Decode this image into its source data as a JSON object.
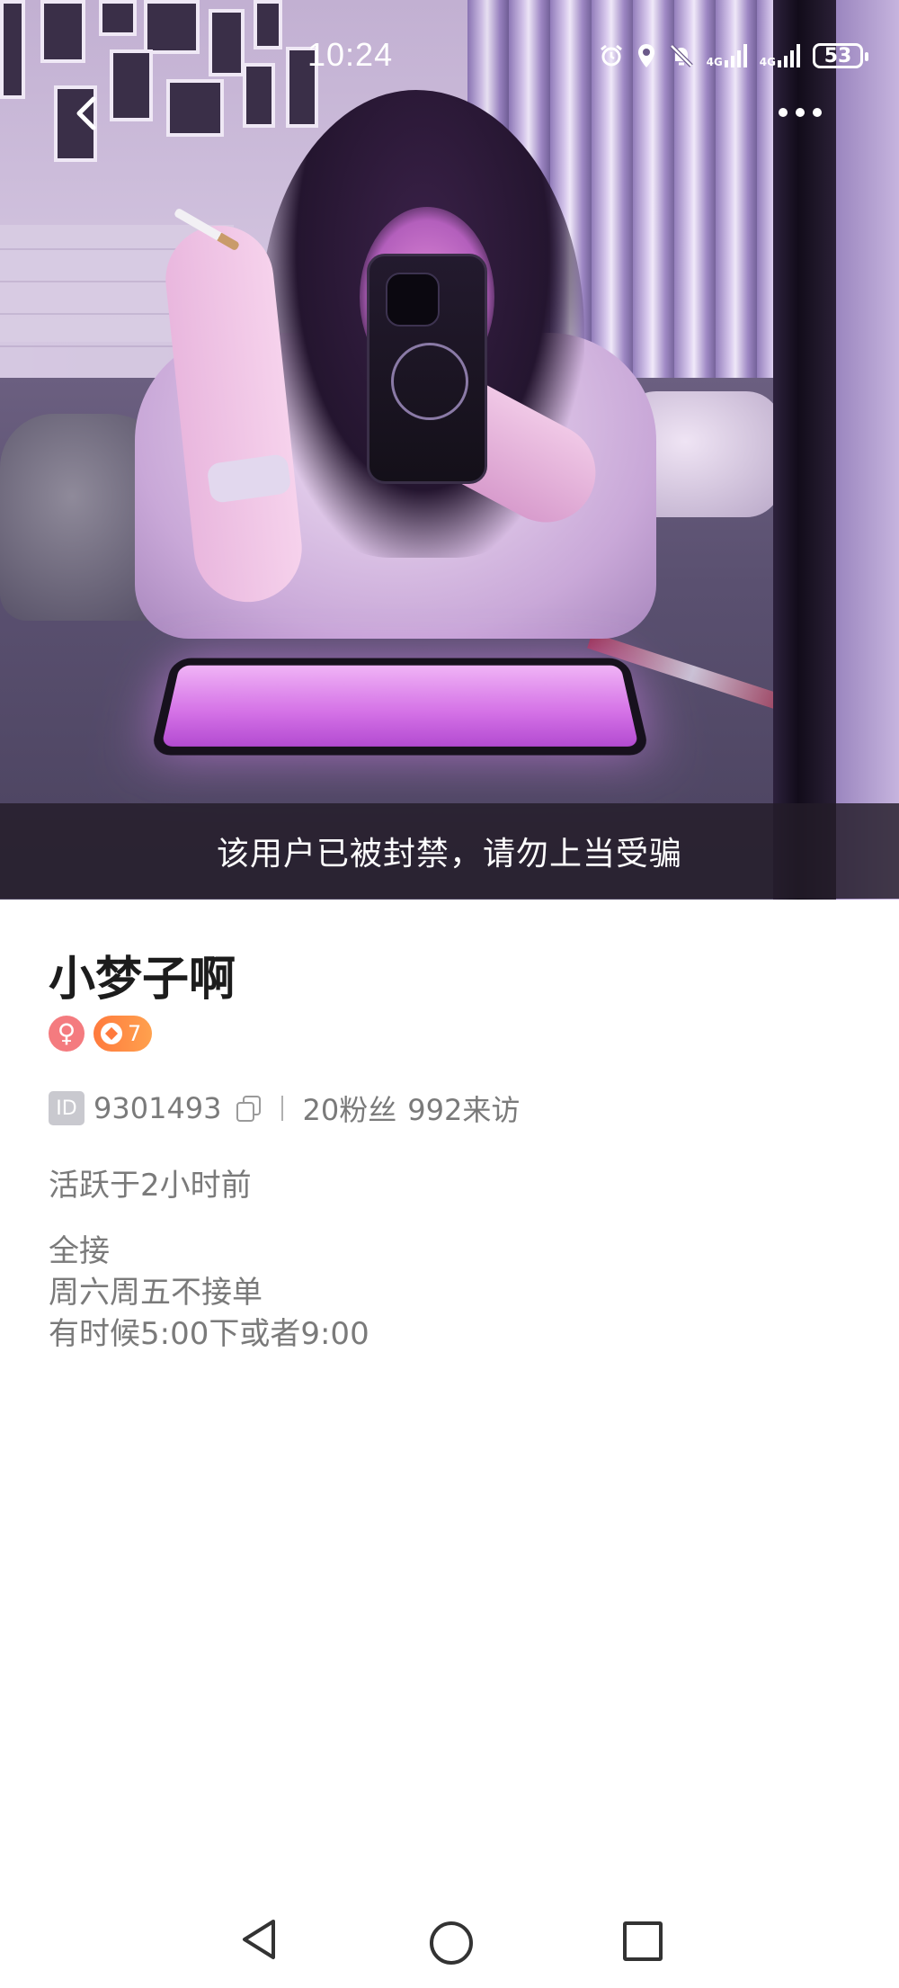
{
  "status_bar": {
    "time": "10:24",
    "network_1": "4G",
    "network_2": "4G",
    "battery": "53"
  },
  "header": {
    "back_icon": "chevron-left-icon",
    "more_icon": "more-horizontal-icon"
  },
  "cover": {
    "ban_notice": "该用户已被封禁，请勿上当受骗"
  },
  "profile": {
    "name": "小梦子啊",
    "gender_symbol": "♀",
    "level": "7",
    "id_label": "ID",
    "id_value": "9301493",
    "fans": "20粉丝",
    "visits": "992来访",
    "active_status": "活跃于2小时前",
    "bio_lines": [
      "全接",
      "周六周五不接单",
      "有时候5:00下或者9:00"
    ]
  },
  "colors": {
    "gender_badge": "#f47b7f",
    "level_badge": "#ff7a3d",
    "ban_banner_bg": "#231c28"
  }
}
